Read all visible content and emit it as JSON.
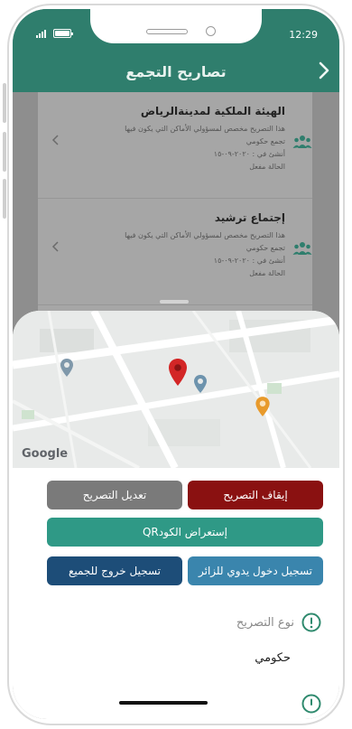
{
  "status": {
    "time": "12:29"
  },
  "header": {
    "title": "تصاريح التجمع"
  },
  "permits": [
    {
      "name": "الهيئة الملكية لمدينةالرياض",
      "desc_line1": "هذا التصريح مخصص لمسؤولي الأماكن التي يكون فيها",
      "desc_line2": "تجمع حكومي",
      "created": "أنشئ في : ٢٠٢٠-٠٩-١٥",
      "status": "الحالة مفعل"
    },
    {
      "name": "إجتماع ترشيد",
      "desc_line1": "هذا التصريح مخصص لمسؤولي الأماكن التي يكون فيها",
      "desc_line2": "تجمع حكومي",
      "created": "أنشئ في : ٢٠٢٠-٠٩-١٥",
      "status": "الحالة مفعل"
    }
  ],
  "map": {
    "logo": "Google"
  },
  "actions": {
    "stop": "إيقاف التصريح",
    "edit": "تعديل التصريح",
    "qr": "إستعراض الكودQR",
    "manual_checkin": "تسجيل دخول يدوي للزائر",
    "exit_all": "تسجيل خروج للجميع"
  },
  "details": {
    "type_label": "نوع التصريح",
    "type_value": "حكومي"
  },
  "colors": {
    "header": "#2f7e6d",
    "stop": "#8a1111",
    "edit": "#7a7a7a",
    "qr": "#2f9986",
    "manual": "#3a85ad",
    "exit": "#1d4d78"
  },
  "icons": {
    "back": "chevron-right-icon",
    "group": "group-icon",
    "item_chevron": "chevron-left-icon",
    "pin": "map-pin-icon",
    "info": "info-circle-icon"
  }
}
